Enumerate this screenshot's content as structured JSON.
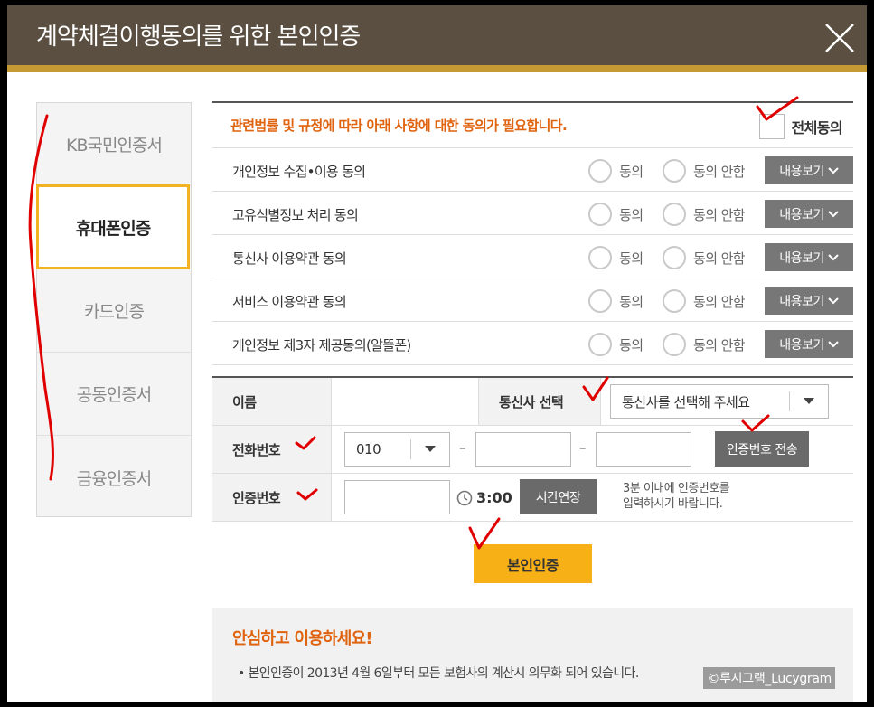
{
  "title": "계약체결이행동의를 위한 본인인증",
  "sidebar": {
    "items": [
      {
        "label": "KB국민인증서"
      },
      {
        "label": "휴대폰인증",
        "active": true
      },
      {
        "label": "카드인증"
      },
      {
        "label": "공동인증서"
      },
      {
        "label": "금융인증서"
      }
    ]
  },
  "consent": {
    "message": "관련법률 및 규정에 따라 아래 사항에 대한 동의가 필요합니다.",
    "agree_all_label": "전체동의",
    "agree_label": "동의",
    "disagree_label": "동의 안함",
    "view_label": "내용보기",
    "items": [
      {
        "title": "개인정보 수집•이용 동의"
      },
      {
        "title": "고유식별정보 처리 동의"
      },
      {
        "title": "통신사 이용약관 동의"
      },
      {
        "title": "서비스 이용약관 동의"
      },
      {
        "title": "개인정보 제3자 제공동의(알뜰폰)"
      }
    ]
  },
  "form": {
    "name_label": "이름",
    "carrier_label": "통신사 선택",
    "carrier_value": "통신사를 선택해 주세요",
    "phone_label": "전화번호",
    "phone_prefix": "010",
    "dash": "–",
    "send_code_label": "인증번호 전송",
    "code_label": "인증번호",
    "timer": "3:00",
    "extend_label": "시간연장",
    "note_line1": "3분 이내에 인증번호를",
    "note_line2": "입력하시기 바랍니다."
  },
  "verify_label": "본인인증",
  "notice": {
    "title": "안심하고 이용하세요!",
    "bullet": "• 본인인증이 2013년 4월 6일부터 모든 보험사의 계산시 의무화 되어 있습니다."
  },
  "watermark": "©루시그램_Lucygram",
  "colors": {
    "titlebar": "#5a4f41",
    "accent": "#c59a34",
    "highlight": "#f3b321",
    "orange_text": "#e0630f",
    "primary_button": "#f7b016",
    "annotation_red": "#e00000"
  }
}
